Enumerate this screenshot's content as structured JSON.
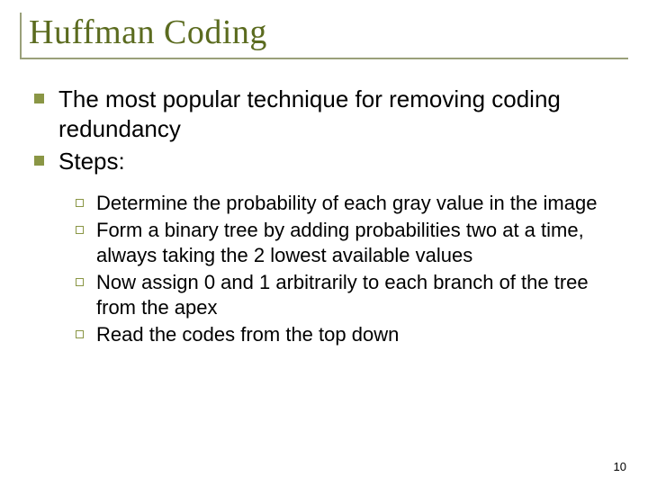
{
  "title": "Huffman Coding",
  "bullets": [
    {
      "text": "The most popular technique for removing coding redundancy"
    },
    {
      "text": "Steps:"
    }
  ],
  "sub_bullets": [
    {
      "text": "Determine the probability of each gray value in the image"
    },
    {
      "text": "Form a binary tree by adding probabilities two at a time, always taking the 2 lowest available values"
    },
    {
      "text": "Now assign 0 and 1 arbitrarily to each branch of the tree from the apex"
    },
    {
      "text": "Read the codes from the top down"
    }
  ],
  "page_number": "10"
}
